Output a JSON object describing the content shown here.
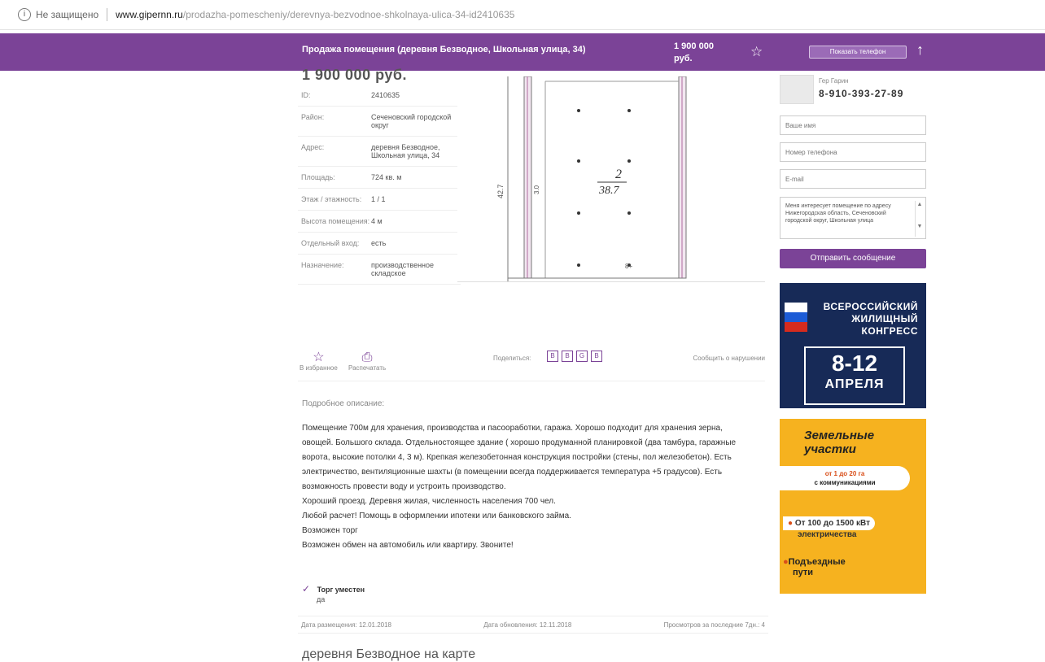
{
  "browser": {
    "security": "Не защищено",
    "domain": "www.gipernn.ru",
    "path": "/prodazha-pomescheniy/derevnya-bezvodnoe-shkolnaya-ulica-34-id2410635"
  },
  "header": {
    "title": "Продажа помещения (деревня Безводное, Школьная улица, 34)",
    "price_line1": "1 900 000",
    "price_line2": "руб.",
    "star_icon": "star-outline-icon",
    "call_button": "Показать телефон",
    "up_icon": "arrow-up-icon"
  },
  "listing": {
    "price_big": "1 900 000 руб."
  },
  "specs": [
    {
      "key": "ID:",
      "value": "2410635"
    },
    {
      "key": "Район:",
      "value": "Сеченовский городской округ"
    },
    {
      "key": "Адрес:",
      "value": "деревня Безводное, Школьная улица, 34"
    },
    {
      "key": "Площадь:",
      "value": "724 кв. м"
    },
    {
      "key": "Этаж / этажность:",
      "value": "1 / 1"
    },
    {
      "key": "Высота помещения:",
      "value": "4 м"
    },
    {
      "key": "Отдельный вход:",
      "value": "есть"
    },
    {
      "key": "Назначение:",
      "value": "производственное складское"
    }
  ],
  "plan": {
    "room_number": "2",
    "room_area": "38.7",
    "dim_left": "42.7",
    "dim_inner": "3.0",
    "mark": "8+"
  },
  "actions": {
    "favorite": "В избранное",
    "print": "Распечатать",
    "share_label": "Поделиться:",
    "share_icons": [
      "В",
      "В",
      "G",
      "В"
    ],
    "report": "Сообщить о нарушении"
  },
  "description": {
    "title": "Подробное описание:",
    "paragraphs": [
      "Помещение 700м для хранения, производства и пасооработки, гаража. Хорошо подходит для хранения зерна, овощей. Большого склада. Отдельностоящее здание ( хорошо продуманной планировкой (два тамбура, гаражные ворота, высокие потолки 4, 3 м). Крепкая железобетонная конструкция постройки (стены, пол железобетон). Есть электричество, вентиляционные шахты (в помещении всегда поддерживается температура +5 градусов). Есть возможность провести воду и устроить производство.",
      "Хороший проезд. Деревня жилая, численность населения 700 чел.",
      "Любой расчет! Помощь в оформлении ипотеки или банковского займа.",
      "Возможен торг",
      "Возможен обмен на автомобиль или квартиру. Звоните!"
    ]
  },
  "bargain": {
    "label": "Торг уместен",
    "value": "да"
  },
  "dates": {
    "placed": "Дата размещения: 12.01.2018",
    "updated": "Дата обновления: 12.11.2018",
    "views": "Просмотров за последние 7дн.: 4"
  },
  "map_title": "деревня Безводное на карте",
  "agent": {
    "name": "Гер Гарин",
    "phone": "8-910-393-27-89"
  },
  "form": {
    "name_placeholder": "Ваше имя",
    "phone_placeholder": "Номер телефона",
    "email_placeholder": "E-mail",
    "message": "Меня интересует помещение по адресу Нижегородская область, Сеченовский городской округ, Школьная улица",
    "send_button": "Отправить сообщение"
  },
  "ad_congress": {
    "line1": "ВСЕРОССИЙСКИЙ",
    "line2": "ЖИЛИЩНЫЙ",
    "line3": "КОНГРЕСС",
    "dates": "8-12",
    "month": "АПРЕЛЯ"
  },
  "ad_land": {
    "title1": "Земельные",
    "title2": "участки",
    "sub1": "от 1 до 20 га",
    "sub2": "с коммуникациями",
    "elec": "От 100 до 1500 кВт",
    "elec2": "электричества",
    "road1": "Подъездные",
    "road2": "пути"
  },
  "colors": {
    "brand": "#7b4397",
    "congress_bg": "#172a57",
    "land_bg": "#f6b21f"
  }
}
